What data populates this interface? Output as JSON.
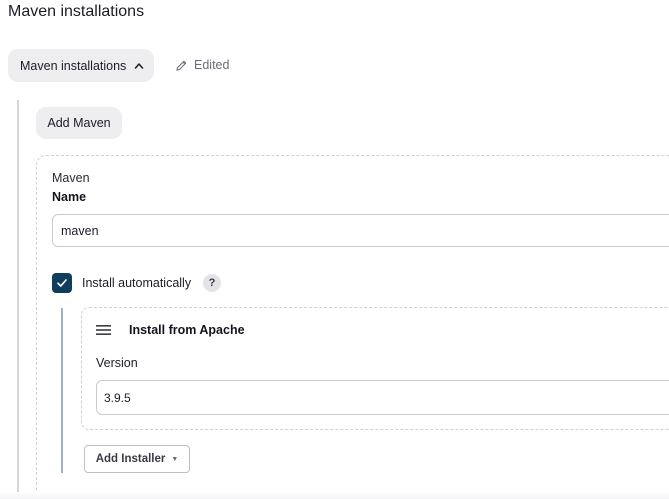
{
  "section": {
    "title": "Maven installations"
  },
  "toolbar": {
    "toggle_label": "Maven installations",
    "toggle_icon": "chevron-up-icon",
    "edited_label": "Edited",
    "edited_icon": "pencil-icon"
  },
  "add_maven_label": "Add Maven",
  "maven": {
    "caption": "Maven",
    "name_label": "Name",
    "name_value": "maven",
    "install_auto_label": "Install automatically",
    "install_auto_checked": true,
    "help_glyph": "?"
  },
  "installer": {
    "title": "Install from Apache",
    "version_label": "Version",
    "version_value": "3.9.5",
    "add_installer_label": "Add Installer",
    "add_installer_caret": "▼"
  },
  "colors": {
    "checkbox_fill": "#0f3d5e",
    "button_bg": "#eeeef1",
    "installer_rule": "#9fb0c1"
  }
}
